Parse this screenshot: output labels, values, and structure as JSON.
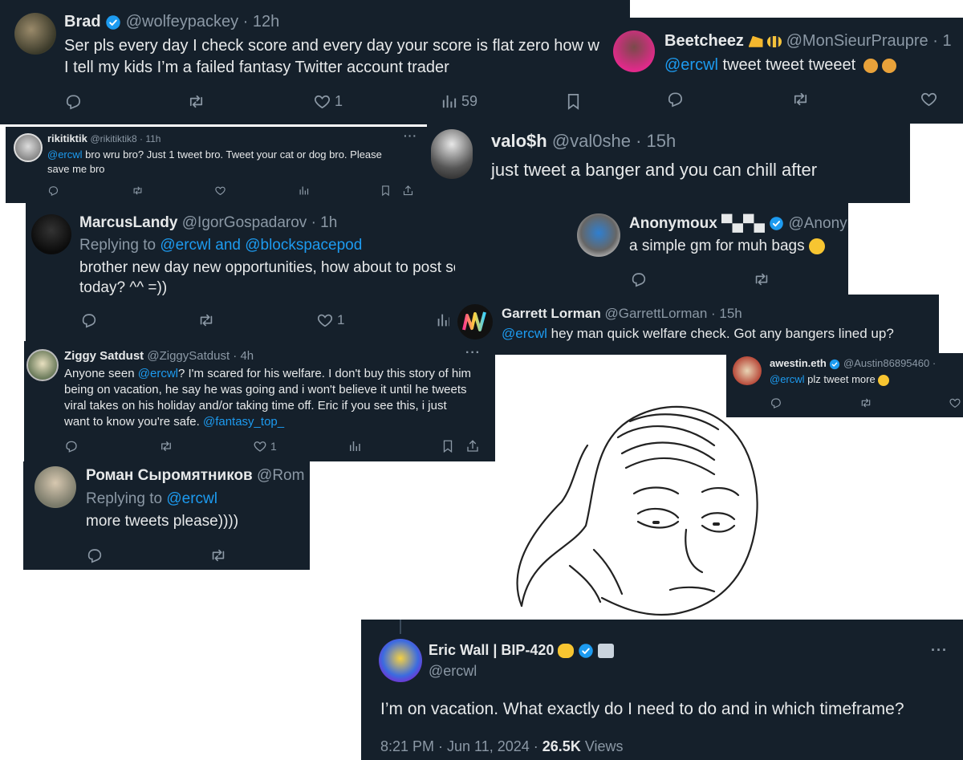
{
  "brad": {
    "name": "Brad",
    "handle": "@wolfeypackey · 12h",
    "line1": "Ser pls every day I check score and every day your score is flat zero how w",
    "line2": "I tell my kids I’m a failed fantasy Twitter account trader",
    "likes": "1",
    "views": "59"
  },
  "beetcheez": {
    "name": "Beetcheez",
    "handle": "@MonSieurPraupre · 1",
    "mention": "@ercwl",
    "text": " tweet tweet tweeet"
  },
  "rikitiktik": {
    "name": "rikitiktik",
    "handle": "@rikitiktik8 · 11h",
    "mention": "@ercwl",
    "line1": " bro wru bro? Just 1 tweet bro. Tweet your cat or dog bro. Please",
    "line2": "save me bro"
  },
  "valosh": {
    "name": "valo$h",
    "handle": "@val0she · 15h",
    "text": "just tweet a banger and you can chill after"
  },
  "marcus": {
    "name": "MarcusLandy",
    "handle": "@IgorGospadarov · 1h",
    "replying": "Replying to ",
    "replying_to": "@ercwl and @blockspacepod",
    "line1": "brother new day new opportunities, how about to post some bangers",
    "line2": "today? ^^ =))",
    "likes": "1"
  },
  "anonymoux": {
    "name": "Anonymoux ▀▄▀▄",
    "handle": "@Anonyr",
    "text": "a simple gm for muh bags"
  },
  "garrett": {
    "name": "Garrett Lorman",
    "handle": "@GarrettLorman · 15h",
    "mention": "@ercwl",
    "text": " hey man quick welfare check. Got any bangers lined up?"
  },
  "awestin": {
    "name": "awestin.eth",
    "handle": "@Austin86895460 ·",
    "mention": "@ercwl",
    "text": " plz tweet more"
  },
  "ziggy": {
    "name": "Ziggy Satdust",
    "handle": "@ZiggySatdust · 4h",
    "l1a": "Anyone seen ",
    "l1m": "@ercwl",
    "l1b": "? I'm scared for his welfare. I don't buy this story of him",
    "l2": "being on vacation, he say he was going and i won't believe it until he tweets",
    "l3": "viral takes on his holiday and/or taking time off. Eric if you see this, i just",
    "l4a": "want to know you're safe. ",
    "l4m": "@fantasy_top_",
    "likes": "1"
  },
  "roman": {
    "name": "Роман Сыромятников",
    "handle": "@Rom",
    "replying": "Replying to ",
    "replying_to": "@ercwl",
    "text": "more tweets please))))"
  },
  "eric": {
    "name": "Eric Wall | BIP-420",
    "handle": "@ercwl",
    "text": "I’m on vacation. What exactly do I need to do and in which timeframe?",
    "time": "8:21 PM · Jun 11, 2024 · ",
    "views_count": "26.5K",
    "views_label": " Views"
  },
  "colors": {
    "bg": "#15202b",
    "text": "#e7e9ea",
    "muted": "#8b98a5",
    "link": "#1d9bf0",
    "verified": "#1d9bf0"
  }
}
